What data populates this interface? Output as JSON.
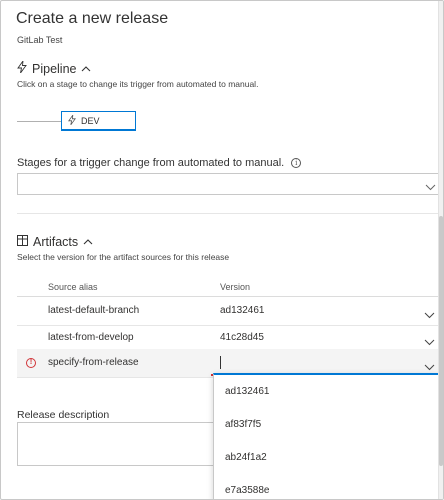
{
  "dialog": {
    "title": "Create a new release",
    "subtitle": "GitLab Test"
  },
  "pipeline": {
    "heading": "Pipeline",
    "hint": "Click on a stage to change its trigger from automated to manual.",
    "stage": {
      "label": "DEV"
    }
  },
  "trigger_change": {
    "label": "Stages for a trigger change from automated to manual.",
    "value": ""
  },
  "artifacts": {
    "heading": "Artifacts",
    "hint": "Select the version for the artifact sources for this release",
    "columns": {
      "source_alias": "Source alias",
      "version": "Version"
    },
    "rows": [
      {
        "alias": "latest-default-branch",
        "version": "ad132461"
      },
      {
        "alias": "latest-from-develop",
        "version": "41c28d45"
      },
      {
        "alias": "specify-from-release",
        "version": ""
      }
    ]
  },
  "version_menu": {
    "options": [
      "ad132461",
      "af83f7f5",
      "ab24f1a2",
      "e7a3588e"
    ]
  },
  "release_description": {
    "label": "Release description",
    "value": ""
  },
  "colors": {
    "accent": "#0078d4",
    "error": "#d13438",
    "border": "#c8c8c8"
  }
}
